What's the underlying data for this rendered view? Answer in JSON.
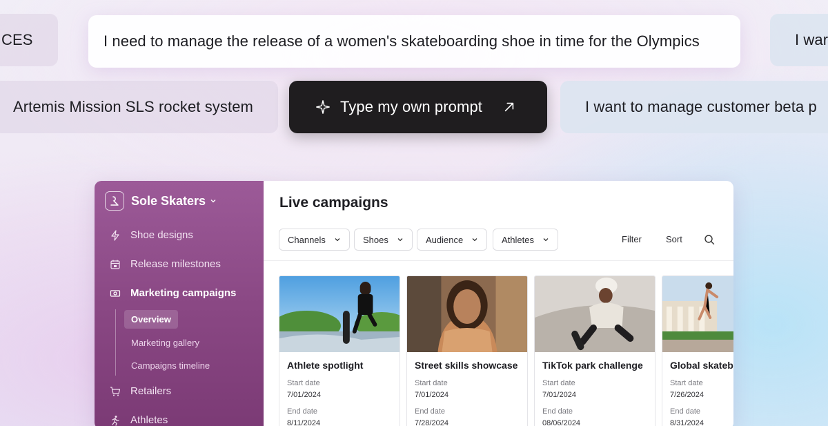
{
  "prompts": {
    "row1": [
      "CES",
      "I need to manage the release of a women's skateboarding shoe in time for the Olympics",
      "I war"
    ],
    "row2": [
      "Artemis Mission SLS rocket system",
      "Type my own prompt",
      "I want to manage customer beta p"
    ]
  },
  "app": {
    "workspace": "Sole Skaters",
    "nav": [
      "Shoe designs",
      "Release milestones",
      "Marketing campaigns",
      "Retailers",
      "Athletes"
    ],
    "nav_icons": [
      "bolt-icon",
      "calendar-icon",
      "money-icon",
      "cart-icon",
      "runner-icon"
    ],
    "subnav": [
      "Overview",
      "Marketing gallery",
      "Campaigns timeline"
    ],
    "main_title": "Live campaigns",
    "filters": [
      "Channels",
      "Shoes",
      "Audience",
      "Athletes"
    ],
    "filter_label": "Filter",
    "sort_label": "Sort",
    "start_label": "Start date",
    "end_label": "End date",
    "campaigns": [
      {
        "title": "Athlete spotlight",
        "start": "7/01/2024",
        "end": "8/11/2024"
      },
      {
        "title": "Street skills showcase",
        "start": "7/01/2024",
        "end": "7/28/2024"
      },
      {
        "title": "TikTok park challenge",
        "start": "7/01/2024",
        "end": "08/06/2024"
      },
      {
        "title": "Global skatebo",
        "start": "7/26/2024",
        "end": "8/31/2024"
      }
    ]
  },
  "colors": {
    "sidebar": "#8a4884",
    "dark_pill": "#1f1d1f",
    "accent_text": "#1f1f24"
  }
}
